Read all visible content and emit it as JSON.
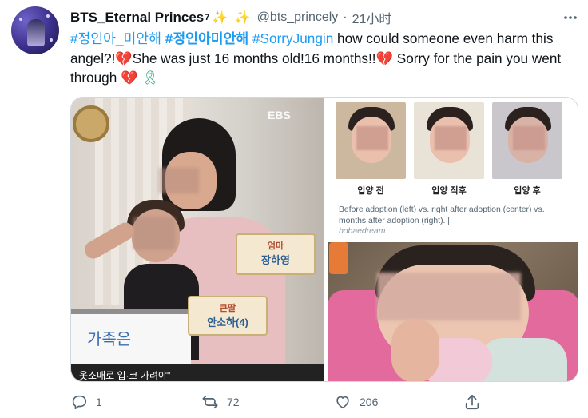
{
  "tweet": {
    "author_name": "BTS_Eternal Princes",
    "author_name_sup": "7",
    "author_sparkles": "✨ ✨",
    "handle": "@bts_princely",
    "separator": "·",
    "time": "21小时",
    "more_icon": "more-icon",
    "text": {
      "tag1": "#정인아_미안해",
      "tag2": "#정인아미안해",
      "tag3": "#SorryJungin",
      "part1": " how could someone even harm this angel?!",
      "heart1": "💔",
      "part2": "She was just 16 months old!16 months!!",
      "heart2": "💔",
      "part3": " Sorry for the pain you went through ",
      "heart3": "💔",
      "ribbon": "🎗"
    }
  },
  "media": {
    "left": {
      "watermark": "EBS",
      "tag1_top": "엄마",
      "tag1_main": "장하영",
      "tag2_top": "큰딸",
      "tag2_main": "안소하(4)",
      "notebook_text": "가족은",
      "caption_bar": "옷소매로 입·코 가려야\""
    },
    "top_right": {
      "labels": [
        "입양 전",
        "입양 직후",
        "입양 후"
      ],
      "caption": "Before adoption (left) vs. right after adoption (center) vs. months after adoption (right). |",
      "credit": "bobaedream"
    }
  },
  "actions": {
    "reply_count": "1",
    "retweet_count": "72",
    "like_count": "206",
    "reply_icon": "reply-icon",
    "retweet_icon": "retweet-icon",
    "like_icon": "heart-outline-icon",
    "share_icon": "share-icon"
  },
  "colors": {
    "accent": "#1d9bf0",
    "text": "#0f1419",
    "muted": "#536471",
    "border": "#cfd9de"
  }
}
